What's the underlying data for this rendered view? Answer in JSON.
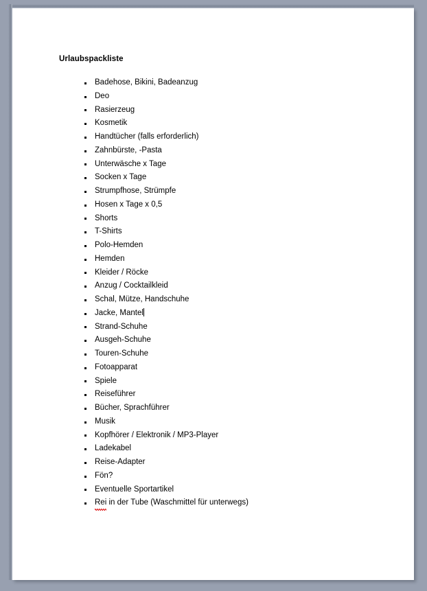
{
  "page": {
    "background_color": "#98a0b0",
    "sheet_color": "#ffffff"
  },
  "document": {
    "title": "Urlaubspackliste",
    "items": [
      {
        "text": "Badehose, Bikini, Badeanzug"
      },
      {
        "text": "Deo"
      },
      {
        "text": "Rasierzeug"
      },
      {
        "text": "Kosmetik"
      },
      {
        "text": "Handtücher (falls erforderlich)"
      },
      {
        "text": "Zahnbürste, -Pasta"
      },
      {
        "text": "Unterwäsche x Tage"
      },
      {
        "text": "Socken x Tage"
      },
      {
        "text": "Strumpfhose, Strümpfe"
      },
      {
        "text": "Hosen x Tage x 0,5"
      },
      {
        "text": "Shorts"
      },
      {
        "text": "T-Shirts"
      },
      {
        "text": "Polo-Hemden"
      },
      {
        "text": "Hemden"
      },
      {
        "text": "Kleider / Röcke"
      },
      {
        "text": "Anzug / Cocktailkleid"
      },
      {
        "text": "Schal, Mütze, Handschuhe"
      },
      {
        "text": "Jacke, Mantel",
        "caret_after": true
      },
      {
        "text": "Strand-Schuhe"
      },
      {
        "text": "Ausgeh-Schuhe"
      },
      {
        "text": "Touren-Schuhe"
      },
      {
        "text": "Fotoapparat"
      },
      {
        "text": "Spiele"
      },
      {
        "text": "Reiseführer"
      },
      {
        "text": "Bücher, Sprachführer"
      },
      {
        "text": "Musik"
      },
      {
        "text": "Kopfhörer / Elektronik / MP3-Player"
      },
      {
        "text": "Ladekabel"
      },
      {
        "text": "Reise-Adapter"
      },
      {
        "text": "Fön?"
      },
      {
        "text": "Eventuelle Sportartikel"
      },
      {
        "misspelled": "Rei",
        "text": " in der Tube (Waschmittel für unterwegs)",
        "spellcheck_color": "#e02020"
      }
    ]
  }
}
